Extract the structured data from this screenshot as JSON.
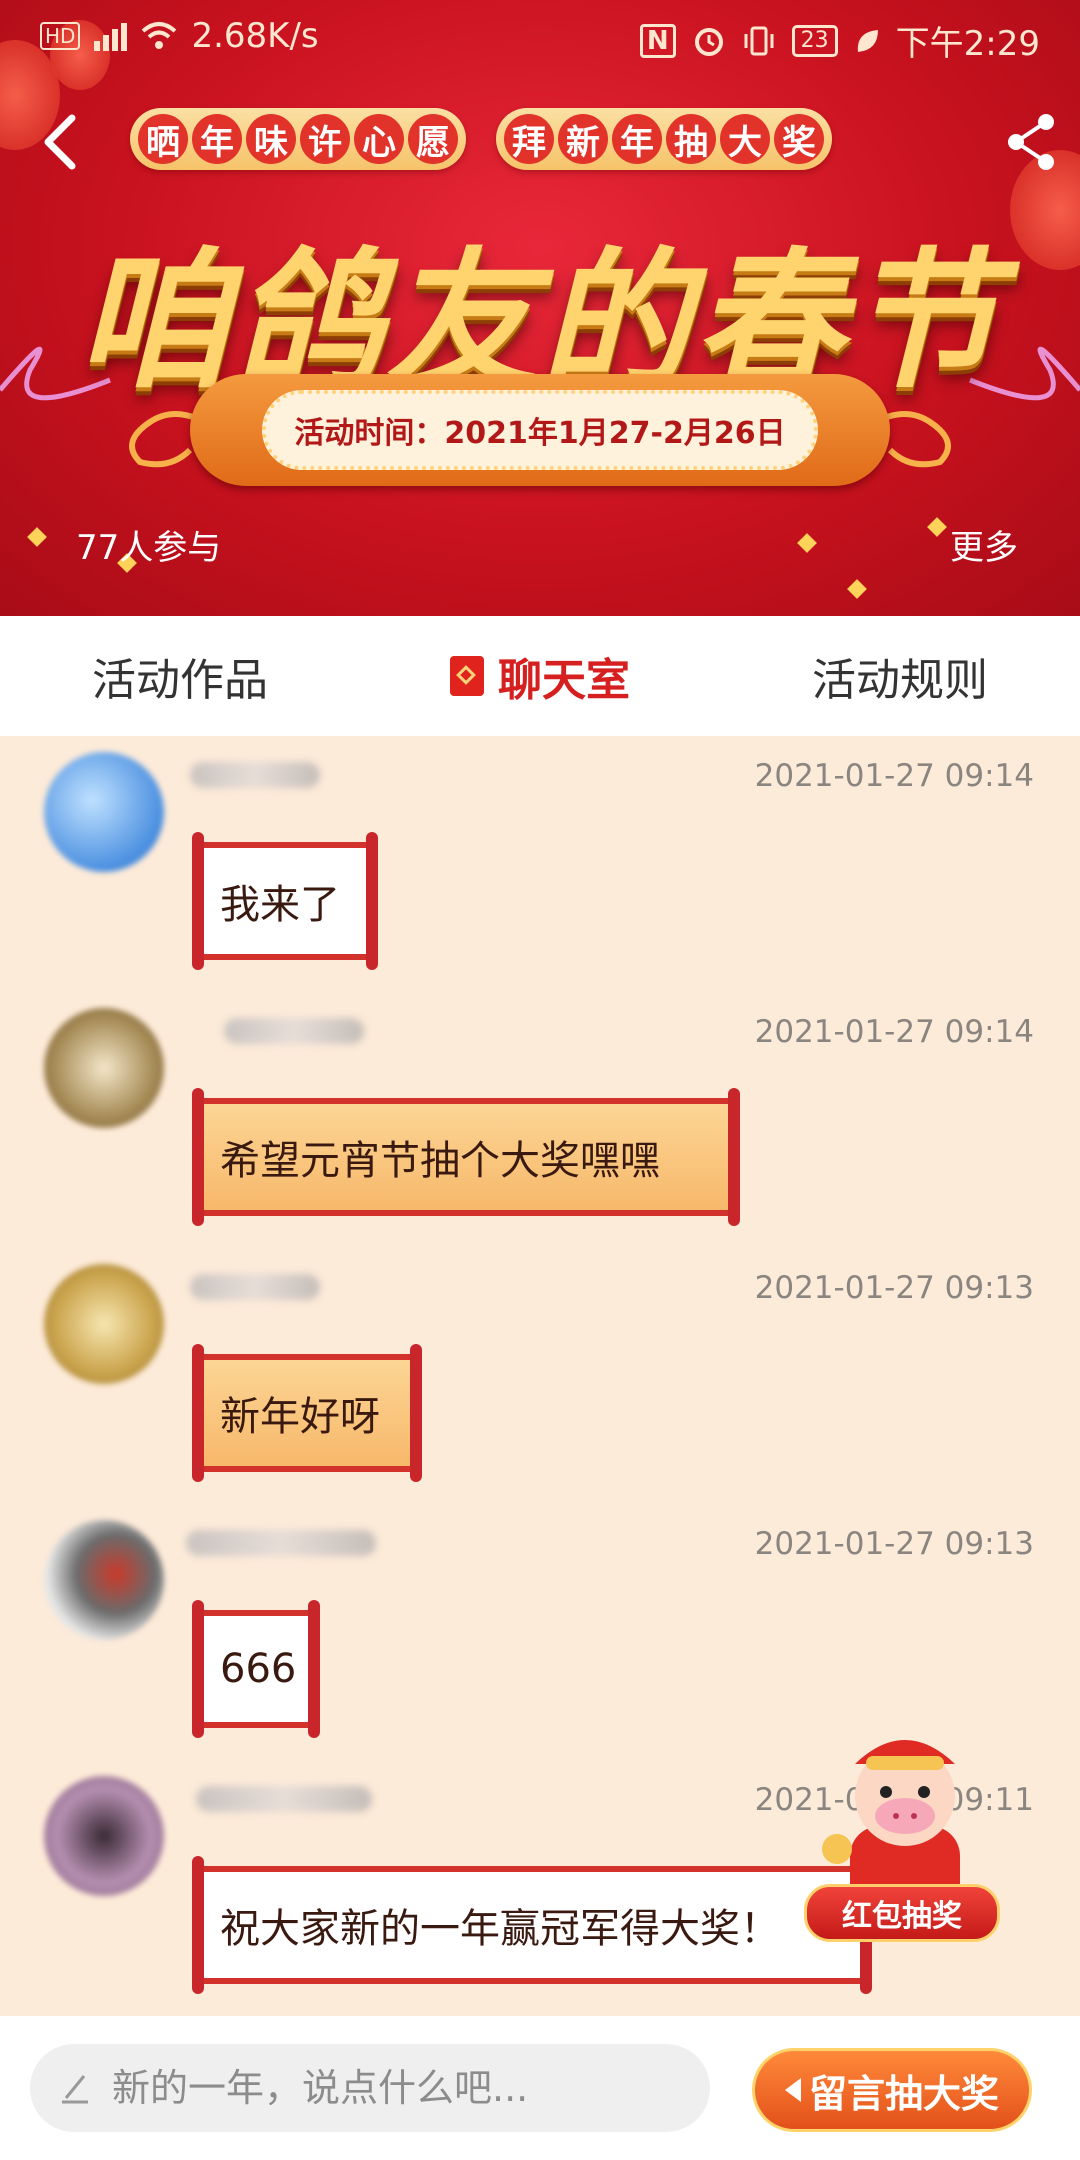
{
  "status_bar": {
    "network_speed": "2.68K/s",
    "battery": "23",
    "time": "下午2:29",
    "hd_label": "HD"
  },
  "banner": {
    "tag_group_1": [
      "晒",
      "年",
      "味",
      "许",
      "心",
      "愿"
    ],
    "tag_group_2": [
      "拜",
      "新",
      "年",
      "抽",
      "大",
      "奖"
    ],
    "title": "咱鸽友的春节",
    "date_text": "活动时间：2021年1月27-2月26日",
    "participants": "77人参与",
    "more": "更多"
  },
  "tabs": {
    "works": "活动作品",
    "chatroom": "聊天室",
    "rules": "活动规则"
  },
  "messages": [
    {
      "time": "2021-01-27 09:14",
      "text": "我来了",
      "style": "white"
    },
    {
      "time": "2021-01-27 09:14",
      "text": "希望元宵节抽个大奖嘿嘿",
      "style": "orange"
    },
    {
      "time": "2021-01-27 09:13",
      "text": "新年好呀",
      "style": "orange"
    },
    {
      "time": "2021-01-27 09:13",
      "text": "666",
      "style": "white"
    },
    {
      "time": "2021-01-27 09:11",
      "text": "祝大家新的一年赢冠军得大奖！",
      "style": "white"
    }
  ],
  "floating": {
    "lucky_draw": "红包抽奖"
  },
  "bottom_bar": {
    "input_placeholder": "新的一年，说点什么吧...",
    "submit_label": "留言抽大奖"
  },
  "colors": {
    "banner_red": "#c9121f",
    "accent_red": "#d6201f",
    "chat_bg": "#fdebd9",
    "gold": "#ffd36e"
  }
}
